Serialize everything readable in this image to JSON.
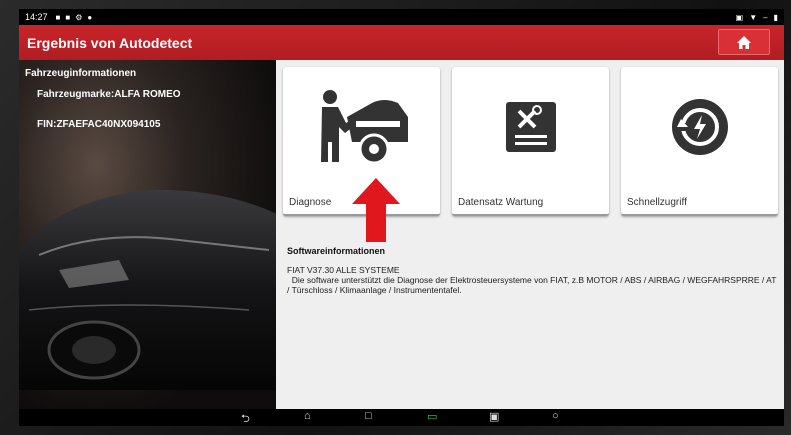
{
  "statusbar": {
    "time": "14:27"
  },
  "titlebar": {
    "title": "Ergebnis von Autodetect"
  },
  "vehicle": {
    "heading": "Fahrzeuginformationen",
    "brand": "Fahrzeugmarke:ALFA ROMEO",
    "vin": "FIN:ZFAEFAC40NX094105"
  },
  "tiles": [
    {
      "label": "Diagnose",
      "icon": "mechanic-car-icon"
    },
    {
      "label": "Datensatz Wartung",
      "icon": "tools-document-icon"
    },
    {
      "label": "Schnellzugriff",
      "icon": "quick-access-icon"
    }
  ],
  "software": {
    "heading": "Softwareinformationen",
    "name": "FIAT V37.30 ALLE SYSTEME",
    "description": "Die software unterstützt die Diagnose der Elektrosteuersysteme von FIAT, z.B MOTOR / ABS / AIRBAG / WEGFAHRSPRRE / AT / Türschloss / Klimaanlage / Instrumententafel."
  },
  "colors": {
    "header_red": "#c8252a",
    "arrow_red": "#e0171c",
    "icon_dark": "#333333"
  }
}
